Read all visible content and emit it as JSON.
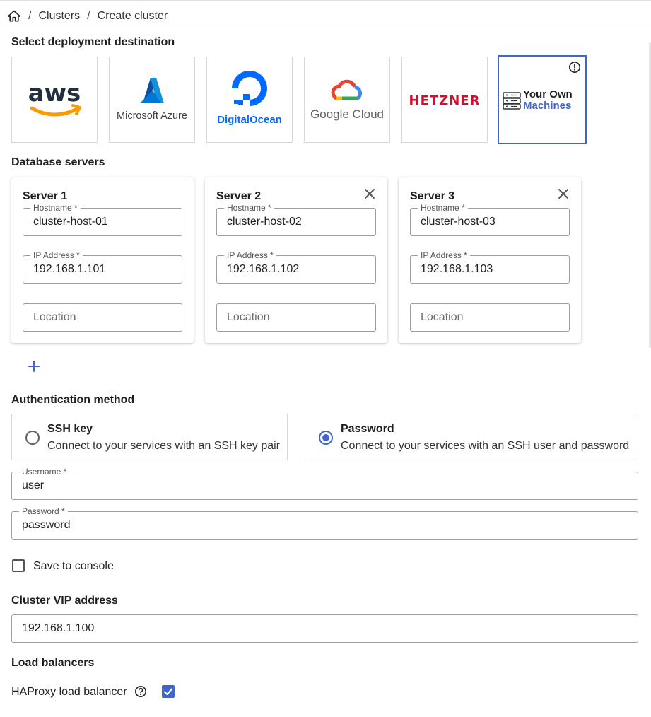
{
  "breadcrumb": {
    "items": [
      "Clusters",
      "Create cluster"
    ],
    "separator": "/"
  },
  "deployment": {
    "title": "Select deployment destination",
    "providers": [
      {
        "id": "aws",
        "label": "aws"
      },
      {
        "id": "azure",
        "label": "Microsoft Azure"
      },
      {
        "id": "digitalocean",
        "label": "DigitalOcean"
      },
      {
        "id": "gcp",
        "label": "Google Cloud"
      },
      {
        "id": "hetzner",
        "label": "HETZNER"
      },
      {
        "id": "own",
        "label_line1": "Your Own",
        "label_line2": "Machines",
        "selected": true
      }
    ]
  },
  "servers": {
    "title": "Database servers",
    "items": [
      {
        "title": "Server 1",
        "hostname_label": "Hostname *",
        "hostname": "cluster-host-01",
        "ip_label": "IP Address *",
        "ip": "192.168.1.101",
        "location_placeholder": "Location",
        "removable": false
      },
      {
        "title": "Server 2",
        "hostname_label": "Hostname *",
        "hostname": "cluster-host-02",
        "ip_label": "IP Address *",
        "ip": "192.168.1.102",
        "location_placeholder": "Location",
        "removable": true
      },
      {
        "title": "Server 3",
        "hostname_label": "Hostname *",
        "hostname": "cluster-host-03",
        "ip_label": "IP Address *",
        "ip": "192.168.1.103",
        "location_placeholder": "Location",
        "removable": true
      }
    ]
  },
  "auth": {
    "title": "Authentication method",
    "options": [
      {
        "title": "SSH key",
        "desc": "Connect to your services with an SSH key pair",
        "selected": false
      },
      {
        "title": "Password",
        "desc": "Connect to your services with an SSH user and password",
        "selected": true
      }
    ],
    "username_label": "Username *",
    "username": "user",
    "password_label": "Password *",
    "password": "password",
    "save_label": "Save to console",
    "save_checked": false
  },
  "vip": {
    "title": "Cluster VIP address",
    "value": "192.168.1.100"
  },
  "load_balancers": {
    "title": "Load balancers",
    "haproxy_label": "HAProxy load balancer",
    "haproxy_checked": true
  },
  "colors": {
    "accent": "#3f67c7",
    "aws_orange": "#f90",
    "azure_blue": "#0078d4",
    "do_blue": "#0069ff",
    "hetzner_red": "#d50c2d"
  }
}
